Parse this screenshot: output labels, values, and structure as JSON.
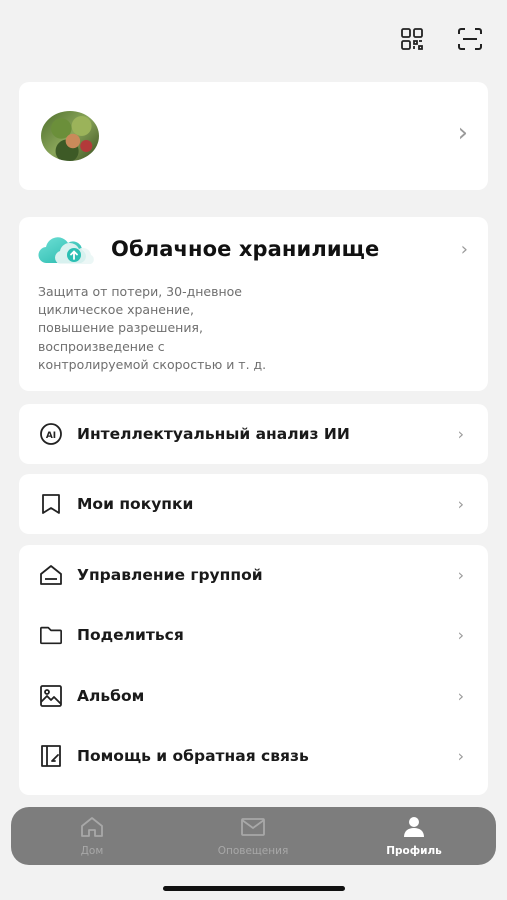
{
  "header": {
    "qr_icon": "qr-code-icon",
    "scan_icon": "scan-icon"
  },
  "profile": {
    "avatar": "avatar-photo",
    "chevron": "›"
  },
  "cloud": {
    "title": "Облачное хранилище",
    "description_lines": [
      "Защита от потери, 30-дневное",
      "циклическое хранение,",
      "повышение разрешения,",
      "воспроизведение с",
      "контролируемой скоростью и т. д."
    ],
    "icon": "cloud-upload-icon",
    "chevron": "›"
  },
  "menu": {
    "ai": {
      "label": "Интеллектуальный анализ ИИ",
      "icon": "ai-icon"
    },
    "purchases": {
      "label": "Мои покупки",
      "icon": "bookmark-icon"
    },
    "group": [
      {
        "label": "Управление группой",
        "icon": "home-group-icon"
      },
      {
        "label": "Поделиться",
        "icon": "folder-icon"
      },
      {
        "label": "Альбом",
        "icon": "image-icon"
      },
      {
        "label": "Помощь и обратная связь",
        "icon": "feedback-icon"
      }
    ],
    "chevron": "›"
  },
  "tabbar": {
    "tabs": [
      {
        "label": "Дом",
        "icon": "home-icon",
        "active": false
      },
      {
        "label": "Оповещения",
        "icon": "mail-icon",
        "active": false
      },
      {
        "label": "Профиль",
        "icon": "person-icon",
        "active": true
      }
    ]
  },
  "colors": {
    "background": "#f2f2f2",
    "card": "#ffffff",
    "accent_cloud": "#2bbfb3",
    "tabbar": "#7d7d7d"
  }
}
